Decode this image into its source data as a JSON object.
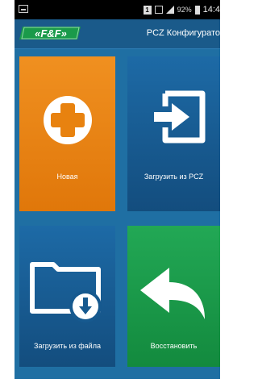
{
  "statusbar": {
    "sim_label": "1",
    "battery_percent": "92%",
    "time": "14:4"
  },
  "appbar": {
    "logo_text": "F&F",
    "title": "PCZ Конфигурато"
  },
  "tiles": [
    {
      "label": "Новая",
      "icon": "plus-icon",
      "color": "#e8820f"
    },
    {
      "label": "Загрузить из PCZ",
      "icon": "import-icon",
      "color": "#16598f"
    },
    {
      "label": "Загрузить из файла",
      "icon": "folder-download-icon",
      "color": "#16598f"
    },
    {
      "label": "Восстановить",
      "icon": "undo-arrow-icon",
      "color": "#1a9a4a"
    }
  ],
  "colors": {
    "background": "#1f6fa3",
    "appbar": "#1a5a8a",
    "orange_tile": "#e8820f",
    "blue_tile": "#16598f",
    "green_tile": "#1a9a4a"
  }
}
